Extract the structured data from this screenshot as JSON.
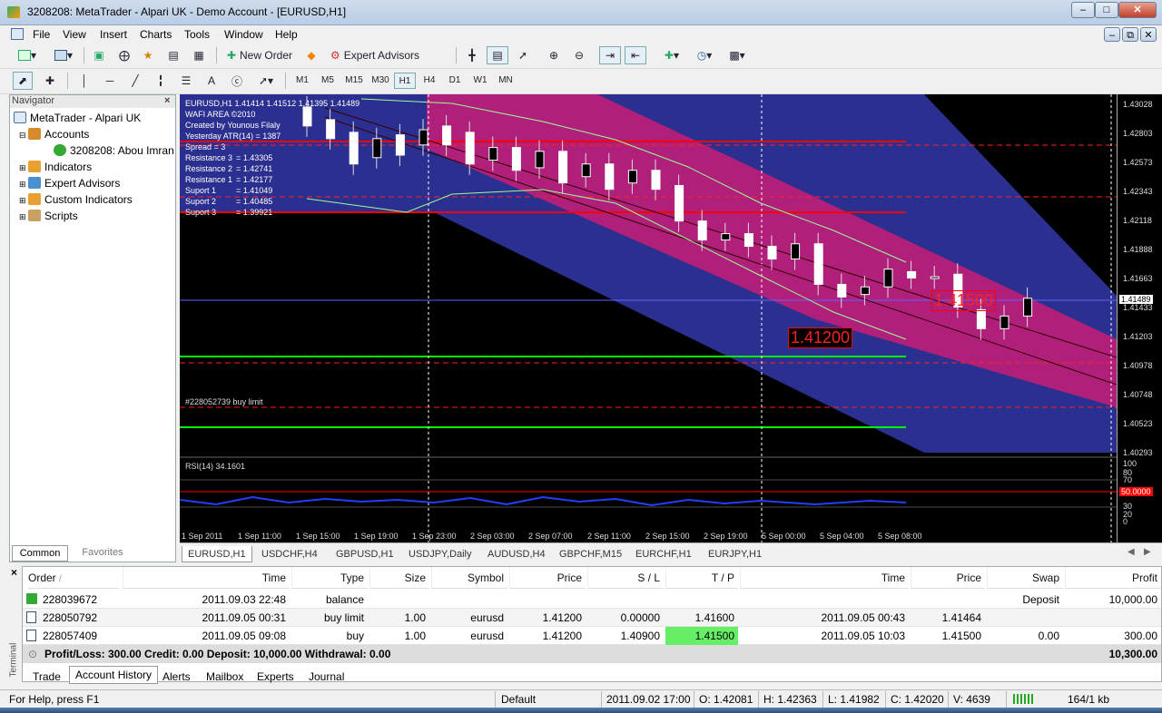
{
  "window": {
    "title": "3208208: MetaTrader - Alpari UK - Demo Account - [EURUSD,H1]"
  },
  "menu": [
    "File",
    "View",
    "Insert",
    "Charts",
    "Tools",
    "Window",
    "Help"
  ],
  "toolbar": {
    "new_order": "New Order",
    "expert_advisors": "Expert Advisors",
    "timeframes": [
      "M1",
      "M5",
      "M15",
      "M30",
      "H1",
      "H4",
      "D1",
      "W1",
      "MN"
    ],
    "active_timeframe": "H1"
  },
  "navigator": {
    "title": "Navigator",
    "root": "MetaTrader - Alpari UK",
    "accounts": "Accounts",
    "account": "3208208: Abou Imran",
    "indicators": "Indicators",
    "expert_advisors": "Expert Advisors",
    "custom_indicators": "Custom Indicators",
    "scripts": "Scripts",
    "tabs": [
      "Common",
      "Favorites"
    ]
  },
  "chart": {
    "header": "EURUSD,H1  1.41414 1.41512 1.41395 1.41489",
    "info_lines": [
      "WAFI AREA ©2010",
      "Created by Younous Filaly",
      "Yesterday ATR(14) = 1387",
      "Spread = 3"
    ],
    "levels": [
      {
        "label": "Resistance 3",
        "value": "1.43305"
      },
      {
        "label": "Resistance 2",
        "value": "1.42741"
      },
      {
        "label": "Resistance 1",
        "value": "1.42177"
      },
      {
        "label": "Suport 1",
        "value": "1.41049"
      },
      {
        "label": "Suport 2",
        "value": "1.40485"
      },
      {
        "label": "Suport 3",
        "value": "1.39921"
      }
    ],
    "order_label": "#228052739 buy limit",
    "price_box_1": "1.41200",
    "price_box_2": "1.41500",
    "current_price": "1.41489",
    "rsi_label": "RSI(14) 34.1601",
    "rsi_marker": "50.0000",
    "rsi_ticks": [
      "100",
      "80",
      "70",
      "30",
      "20",
      "0"
    ],
    "y_ticks": [
      "1.43028",
      "1.42803",
      "1.42573",
      "1.42343",
      "1.42118",
      "1.41888",
      "1.41663",
      "1.41433",
      "1.41203",
      "1.40978",
      "1.40748",
      "1.40523",
      "1.40293"
    ],
    "x_ticks": [
      "1 Sep 2011",
      "1 Sep 11:00",
      "1 Sep 15:00",
      "1 Sep 19:00",
      "1 Sep 23:00",
      "2 Sep 03:00",
      "2 Sep 07:00",
      "2 Sep 11:00",
      "2 Sep 15:00",
      "2 Sep 19:00",
      "5 Sep 00:00",
      "5 Sep 04:00",
      "5 Sep 08:00"
    ],
    "tabs": [
      "EURUSD,H1",
      "USDCHF,H4",
      "GBPUSD,H1",
      "USDJPY,Daily",
      "AUDUSD,H4",
      "GBPCHF,M15",
      "EURCHF,H1",
      "EURJPY,H1"
    ],
    "colors": {
      "channel_outer": "#2b2f8f",
      "channel_inner": "#b0207a",
      "support": "#00ff00",
      "resistance": "#ff0000"
    }
  },
  "chart_data": {
    "type": "candlestick",
    "symbol": "EURUSD",
    "timeframe": "H1",
    "ylim": [
      1.40293,
      1.43028
    ],
    "candles": [
      {
        "o": 1.43,
        "c": 1.4285
      },
      {
        "o": 1.429,
        "c": 1.4275
      },
      {
        "o": 1.428,
        "c": 1.4255
      },
      {
        "o": 1.426,
        "c": 1.4275
      },
      {
        "o": 1.4278,
        "c": 1.4262
      },
      {
        "o": 1.427,
        "c": 1.4282
      },
      {
        "o": 1.4285,
        "c": 1.427
      },
      {
        "o": 1.428,
        "c": 1.4255
      },
      {
        "o": 1.4258,
        "c": 1.4268
      },
      {
        "o": 1.4268,
        "c": 1.425
      },
      {
        "o": 1.4252,
        "c": 1.4265
      },
      {
        "o": 1.4265,
        "c": 1.424
      },
      {
        "o": 1.4245,
        "c": 1.4255
      },
      {
        "o": 1.4255,
        "c": 1.4235
      },
      {
        "o": 1.424,
        "c": 1.425
      },
      {
        "o": 1.425,
        "c": 1.4235
      },
      {
        "o": 1.4238,
        "c": 1.421
      },
      {
        "o": 1.421,
        "c": 1.4195
      },
      {
        "o": 1.4195,
        "c": 1.42
      },
      {
        "o": 1.42,
        "c": 1.419
      },
      {
        "o": 1.419,
        "c": 1.418
      },
      {
        "o": 1.418,
        "c": 1.4192
      },
      {
        "o": 1.4192,
        "c": 1.416
      },
      {
        "o": 1.416,
        "c": 1.415
      },
      {
        "o": 1.4152,
        "c": 1.4158
      },
      {
        "o": 1.4158,
        "c": 1.4172
      },
      {
        "o": 1.417,
        "c": 1.4165
      },
      {
        "o": 1.4165,
        "c": 1.4166
      },
      {
        "o": 1.4168,
        "c": 1.4142
      },
      {
        "o": 1.414,
        "c": 1.4125
      },
      {
        "o": 1.4125,
        "c": 1.4135
      },
      {
        "o": 1.4135,
        "c": 1.4149
      }
    ],
    "rsi": {
      "value": 34.1601,
      "period": 14
    }
  },
  "terminal": {
    "columns": [
      "Order",
      "Time",
      "Type",
      "Size",
      "Symbol",
      "Price",
      "S / L",
      "T / P",
      "Time",
      "Price",
      "Swap",
      "Profit"
    ],
    "rows": [
      {
        "order": "228039672",
        "time": "2011.09.03 22:48",
        "type": "balance",
        "size": "",
        "symbol": "",
        "price": "",
        "sl": "",
        "tp": "",
        "ctime": "",
        "cprice": "",
        "swap": "Deposit",
        "profit": "10,000.00"
      },
      {
        "order": "228050792",
        "time": "2011.09.05 00:31",
        "type": "buy limit",
        "size": "1.00",
        "symbol": "eurusd",
        "price": "1.41200",
        "sl": "0.00000",
        "tp": "1.41600",
        "ctime": "2011.09.05 00:43",
        "cprice": "1.41464",
        "swap": "",
        "profit": ""
      },
      {
        "order": "228057409",
        "time": "2011.09.05 09:08",
        "type": "buy",
        "size": "1.00",
        "symbol": "eurusd",
        "price": "1.41200",
        "sl": "1.40900",
        "tp": "1.41500",
        "ctime": "2011.09.05 10:03",
        "cprice": "1.41500",
        "swap": "0.00",
        "profit": "300.00"
      }
    ],
    "summary": "Profit/Loss: 300.00  Credit: 0.00  Deposit: 10,000.00  Withdrawal: 0.00",
    "total": "10,300.00",
    "side_label": "Terminal",
    "tabs": [
      "Trade",
      "Account History",
      "Alerts",
      "Mailbox",
      "Experts",
      "Journal"
    ],
    "active_tab": "Account History"
  },
  "status": {
    "help": "For Help, press F1",
    "profile": "Default",
    "time": "2011.09.02 17:00",
    "open": "O: 1.42081",
    "high": "H: 1.42363",
    "low": "L: 1.41982",
    "close": "C: 1.42020",
    "volume": "V: 4639",
    "traffic": "164/1 kb"
  }
}
